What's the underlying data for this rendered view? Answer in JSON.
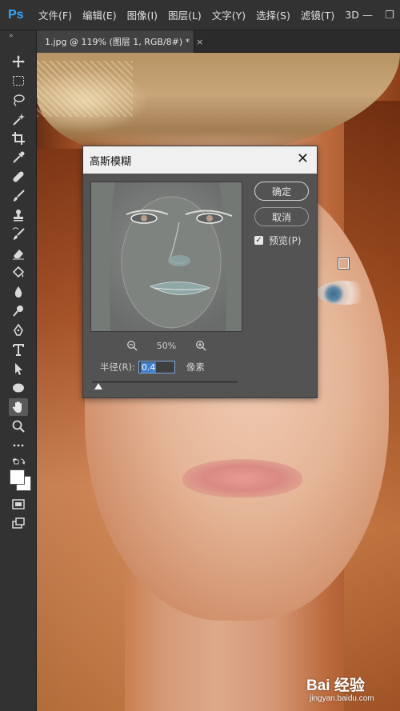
{
  "app": {
    "logo": "Ps"
  },
  "menu": [
    "文件(F)",
    "编辑(E)",
    "图像(I)",
    "图层(L)",
    "文字(Y)",
    "选择(S)",
    "滤镜(T)",
    "3D"
  ],
  "window_controls": {
    "minimize": "—",
    "restore": "❐"
  },
  "tab": {
    "title": "1.jpg @ 119% (图层 1, RGB/8#) *",
    "close": "×"
  },
  "toolbar": {
    "collapse": "»"
  },
  "dialog": {
    "title": "高斯模糊",
    "close": "✕",
    "ok_label": "确定",
    "cancel_label": "取消",
    "preview_label": "预览(P)",
    "preview_checked": true,
    "zoom_level": "50%",
    "radius_label": "半径(R):",
    "radius_value": "0.4",
    "radius_unit": "像素"
  },
  "watermark": {
    "brand": "Bai 经验",
    "url": "jingyan.baidu.com"
  },
  "colors": {
    "accent": "#31a8ff",
    "panel": "#323232",
    "dialog_bg": "#535353",
    "selection": "#3f7fd0"
  }
}
